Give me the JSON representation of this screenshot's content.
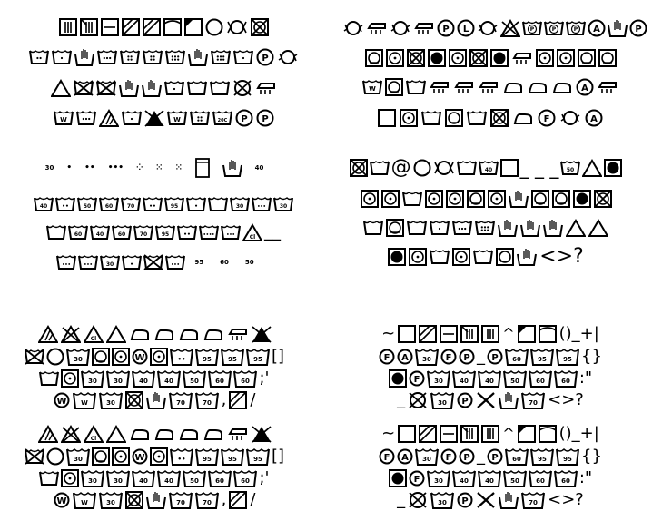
{
  "panels": {
    "top_left": {
      "rows": [
        [
          "sq-bars",
          "sq-bars2",
          "sq-line",
          "sq-diag",
          "sq-diag",
          "sq-arch",
          "sq-diagfill",
          "circle",
          "circle-arrows",
          "sq-x"
        ],
        [
          "tub-2dot",
          "tub-1dot",
          "tub-hand",
          "tub-3dot",
          "tub-4dot",
          "tub-4dot",
          "tub-6dot",
          "tub-hand",
          "tub-6dot",
          "tub-1dot",
          "circ-P",
          "circ-arrow"
        ],
        [
          "tri",
          "tub-x",
          "tub-x",
          "tub-hand",
          "tub-hand",
          "tub-1dot",
          "tub-line",
          "tub-line",
          "circ-x",
          "iron-x"
        ],
        [
          "tub-w",
          "tub-3dot",
          "tri-lines",
          "tub-1dot",
          "tri-fill",
          "tub-w",
          "tub-4dot",
          "tub-20c",
          "circ-P",
          "circ-P"
        ]
      ],
      "tub_label_20c": "20C"
    },
    "top_right": {
      "rows": [
        [
          "circ-arrow",
          "iron-x",
          "circ-arrow",
          "iron-x",
          "circ-P",
          "circ-L",
          "circ-arrow",
          "tri-x",
          "tub-P",
          "tub-P",
          "tub-P",
          "circ-A",
          "tub-hand",
          "circ-P"
        ],
        [
          "sq-circ",
          "sq-dot",
          "sq-x",
          "sq-fill",
          "sq-dot",
          "sq-x",
          "sq-fill",
          "iron-x",
          "sq-dot",
          "sq-dot",
          "sq-circ",
          "sq-circ"
        ],
        [
          "tub-w",
          "sq-circ",
          "tub",
          "iron-x",
          "iron-x",
          "iron-x",
          "iron",
          "iron",
          "iron",
          "circ-A",
          "iron-x"
        ],
        [
          "sq",
          "sq-dot",
          "tub",
          "sq-circ",
          "tub-line",
          "sq-x",
          "iron",
          "circ-F",
          "circ-arrow",
          "circ-A"
        ]
      ]
    },
    "mid_left": {
      "dot_row": [
        "30",
        "•",
        "••",
        "•••",
        "⁘",
        "⁙",
        "⁙",
        "sq-tall",
        "tub-hand",
        "40"
      ],
      "row2_labels": [
        "40",
        "••",
        "50",
        "60",
        "70",
        "••",
        "95",
        "•",
        "",
        "30",
        "•••",
        "30"
      ],
      "row3_labels": [
        "",
        "60",
        "40",
        "60",
        "70",
        "95",
        "••",
        "••••",
        "•••",
        "Cl"
      ],
      "row3_tail": "__",
      "row4_labels": [
        "•••",
        "•••",
        "30",
        "•",
        "",
        "•••"
      ],
      "row4_tail": [
        "95",
        "60",
        "50"
      ]
    },
    "mid_right": {
      "row1_text": "@",
      "row1_tub_label": "40",
      "row1_tail": "_ _ _",
      "row1_tub2_label": "50",
      "row4_tail": "<>?"
    },
    "bottom_left_1": {
      "row2_labels": [
        "30",
        "••",
        "95",
        "95",
        "95"
      ],
      "row2_tail": "[]",
      "row3_labels": [
        "30",
        "30",
        "40",
        "40",
        "50",
        "60",
        "60"
      ],
      "row3_tail": ";'",
      "row4_labels": [
        "W",
        "W",
        "30",
        "",
        "70",
        "70"
      ],
      "row4_tail": ",/"
    },
    "bottom_right_1": {
      "row1_tail": "()_+|",
      "row1_mid": "^",
      "row1_lead": "~",
      "row2_labels": [
        "F",
        "A",
        "30",
        "F",
        "P",
        "P",
        "60",
        "95",
        "95"
      ],
      "row2_tail": "{}",
      "row3_labels": [
        "F",
        "30",
        "40",
        "40",
        "50",
        "60",
        "60"
      ],
      "row3_tail": ":\"",
      "row4_labels": [
        "30",
        "P",
        "30",
        "70"
      ],
      "row4_lead": "_",
      "row4_tail": "<>?"
    }
  }
}
